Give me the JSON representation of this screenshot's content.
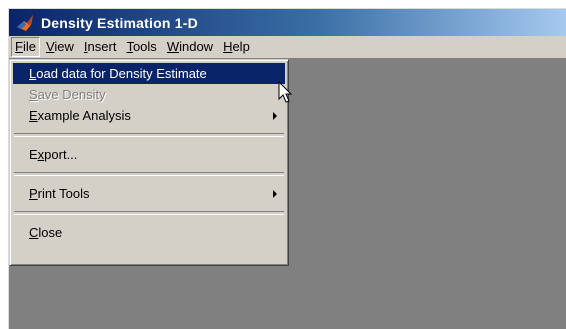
{
  "window": {
    "title": "Density Estimation 1-D",
    "icon": "matlab-logo-icon"
  },
  "menubar": {
    "items": [
      {
        "label": "File",
        "mnemonic": "F"
      },
      {
        "label": "View",
        "mnemonic": "V"
      },
      {
        "label": "Insert",
        "mnemonic": "I"
      },
      {
        "label": "Tools",
        "mnemonic": "T"
      },
      {
        "label": "Window",
        "mnemonic": "W"
      },
      {
        "label": "Help",
        "mnemonic": "H"
      }
    ],
    "open_menu": "File"
  },
  "file_menu": {
    "items": [
      {
        "label": "Load data for Density Estimate",
        "state": "highlighted"
      },
      {
        "label": "Save Density",
        "state": "disabled"
      },
      {
        "label": "Example Analysis",
        "state": "normal",
        "submenu": true
      },
      {
        "label": "Export...",
        "state": "normal"
      },
      {
        "label": "Print Tools",
        "state": "normal",
        "submenu": true
      },
      {
        "label": "Close",
        "state": "normal"
      }
    ]
  },
  "colors": {
    "title_gradient_start": "#0a246a",
    "title_gradient_end": "#a6caf0",
    "menu_face": "#d4d0c8",
    "highlight": "#0a246a",
    "client_area": "#808080"
  }
}
